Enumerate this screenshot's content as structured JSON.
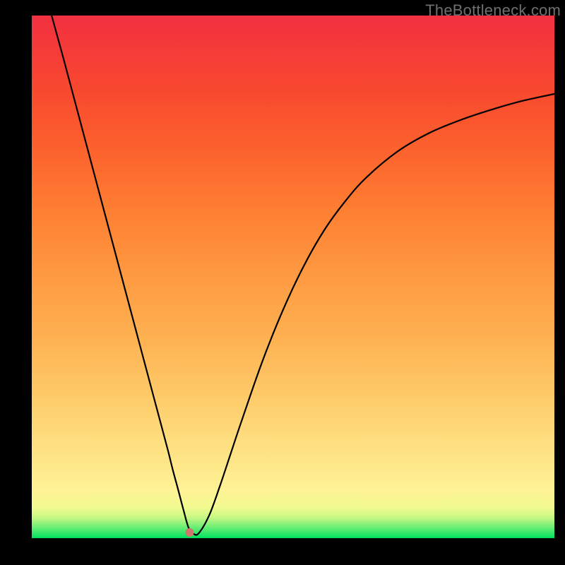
{
  "watermark": "TheBottleneck.com",
  "chart_data": {
    "type": "line",
    "title": "",
    "xlabel": "",
    "ylabel": "",
    "xlim": [
      0,
      100
    ],
    "ylim": [
      0,
      100
    ],
    "x": [
      3.8,
      6,
      8,
      10,
      12,
      14,
      16,
      18,
      20,
      22,
      24,
      26,
      27,
      28,
      29,
      30,
      31,
      32,
      34,
      36,
      38,
      40,
      44,
      48,
      52,
      56,
      60,
      64,
      70,
      76,
      82,
      88,
      94,
      100
    ],
    "values": [
      100,
      92,
      84.5,
      77,
      69.5,
      62,
      54.5,
      47,
      39.5,
      32,
      24.5,
      17,
      13,
      9.3,
      5.5,
      2,
      0.8,
      1,
      4.5,
      10,
      16,
      22,
      33.5,
      43.5,
      52,
      59,
      64.5,
      69,
      74,
      77.5,
      80,
      82,
      83.7,
      85
    ],
    "marker": {
      "x": 30.2,
      "y": 1.1,
      "color": "#cf776b"
    },
    "background_gradient": {
      "direction": "vertical",
      "stops": [
        {
          "pos": 0.0,
          "color": "#f23040"
        },
        {
          "pos": 0.14,
          "color": "#f8482f"
        },
        {
          "pos": 0.26,
          "color": "#fc632d"
        },
        {
          "pos": 0.38,
          "color": "#fe8033"
        },
        {
          "pos": 0.5,
          "color": "#fe9a42"
        },
        {
          "pos": 0.62,
          "color": "#feb252"
        },
        {
          "pos": 0.73,
          "color": "#fecb69"
        },
        {
          "pos": 0.82,
          "color": "#fedf80"
        },
        {
          "pos": 0.91,
          "color": "#fef396"
        },
        {
          "pos": 0.94,
          "color": "#f3fb90"
        },
        {
          "pos": 0.96,
          "color": "#c8f884"
        },
        {
          "pos": 0.98,
          "color": "#66ee75"
        },
        {
          "pos": 1.0,
          "color": "#00e060"
        }
      ]
    }
  }
}
